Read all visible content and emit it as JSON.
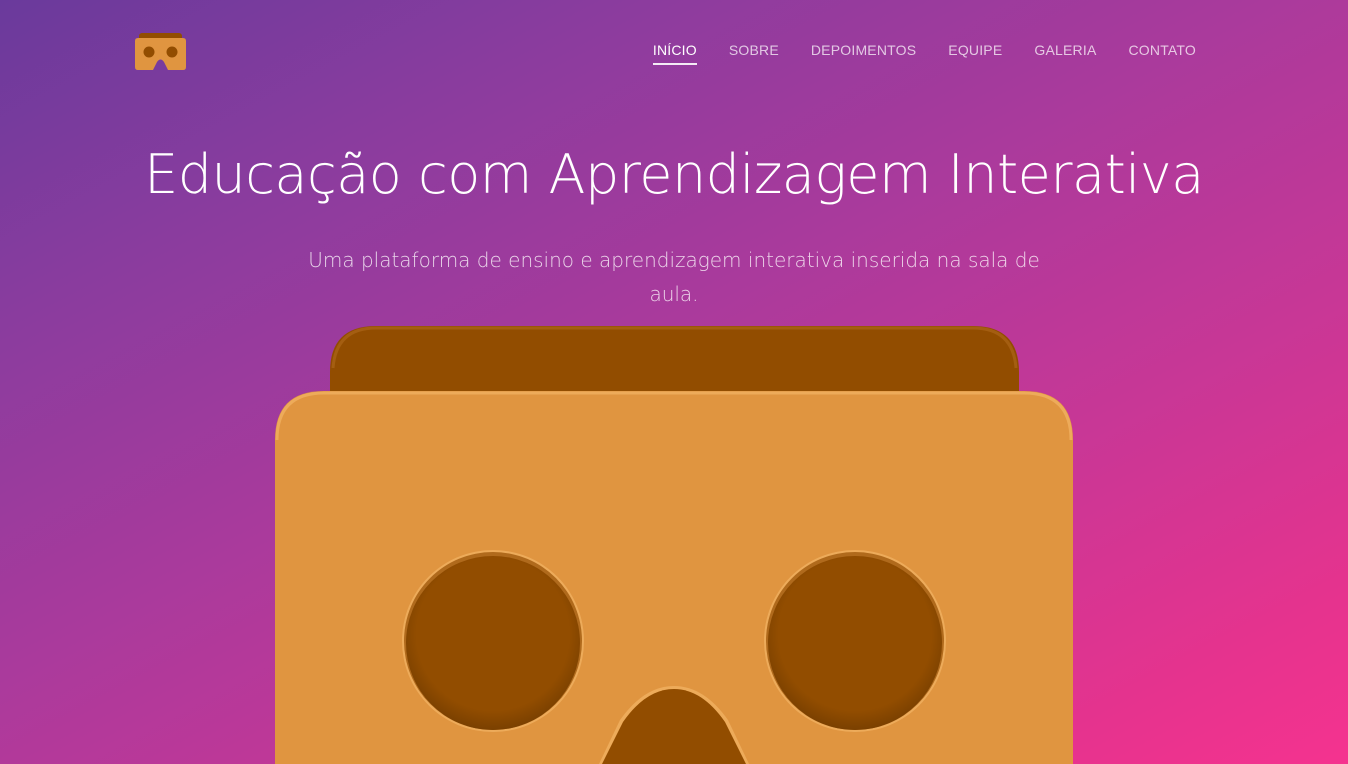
{
  "header": {
    "logo_icon": "cardboard-viewer-icon",
    "nav": [
      {
        "label": "INÍCIO",
        "active": true
      },
      {
        "label": "SOBRE",
        "active": false
      },
      {
        "label": "DEPOIMENTOS",
        "active": false
      },
      {
        "label": "EQUIPE",
        "active": false
      },
      {
        "label": "GALERIA",
        "active": false
      },
      {
        "label": "CONTATO",
        "active": false
      }
    ]
  },
  "hero": {
    "title": "Educação com Aprendizagem Interativa",
    "subtitle": "Uma plataforma de ensino e aprendizagem interativa inserida na sala de aula.",
    "illustration_icon": "cardboard-vr-viewer-illustration"
  },
  "colors": {
    "gradient_start": "#6a3a9c",
    "gradient_end": "#f5338f",
    "cardboard_light": "#e09540",
    "cardboard_dark": "#924d00"
  }
}
